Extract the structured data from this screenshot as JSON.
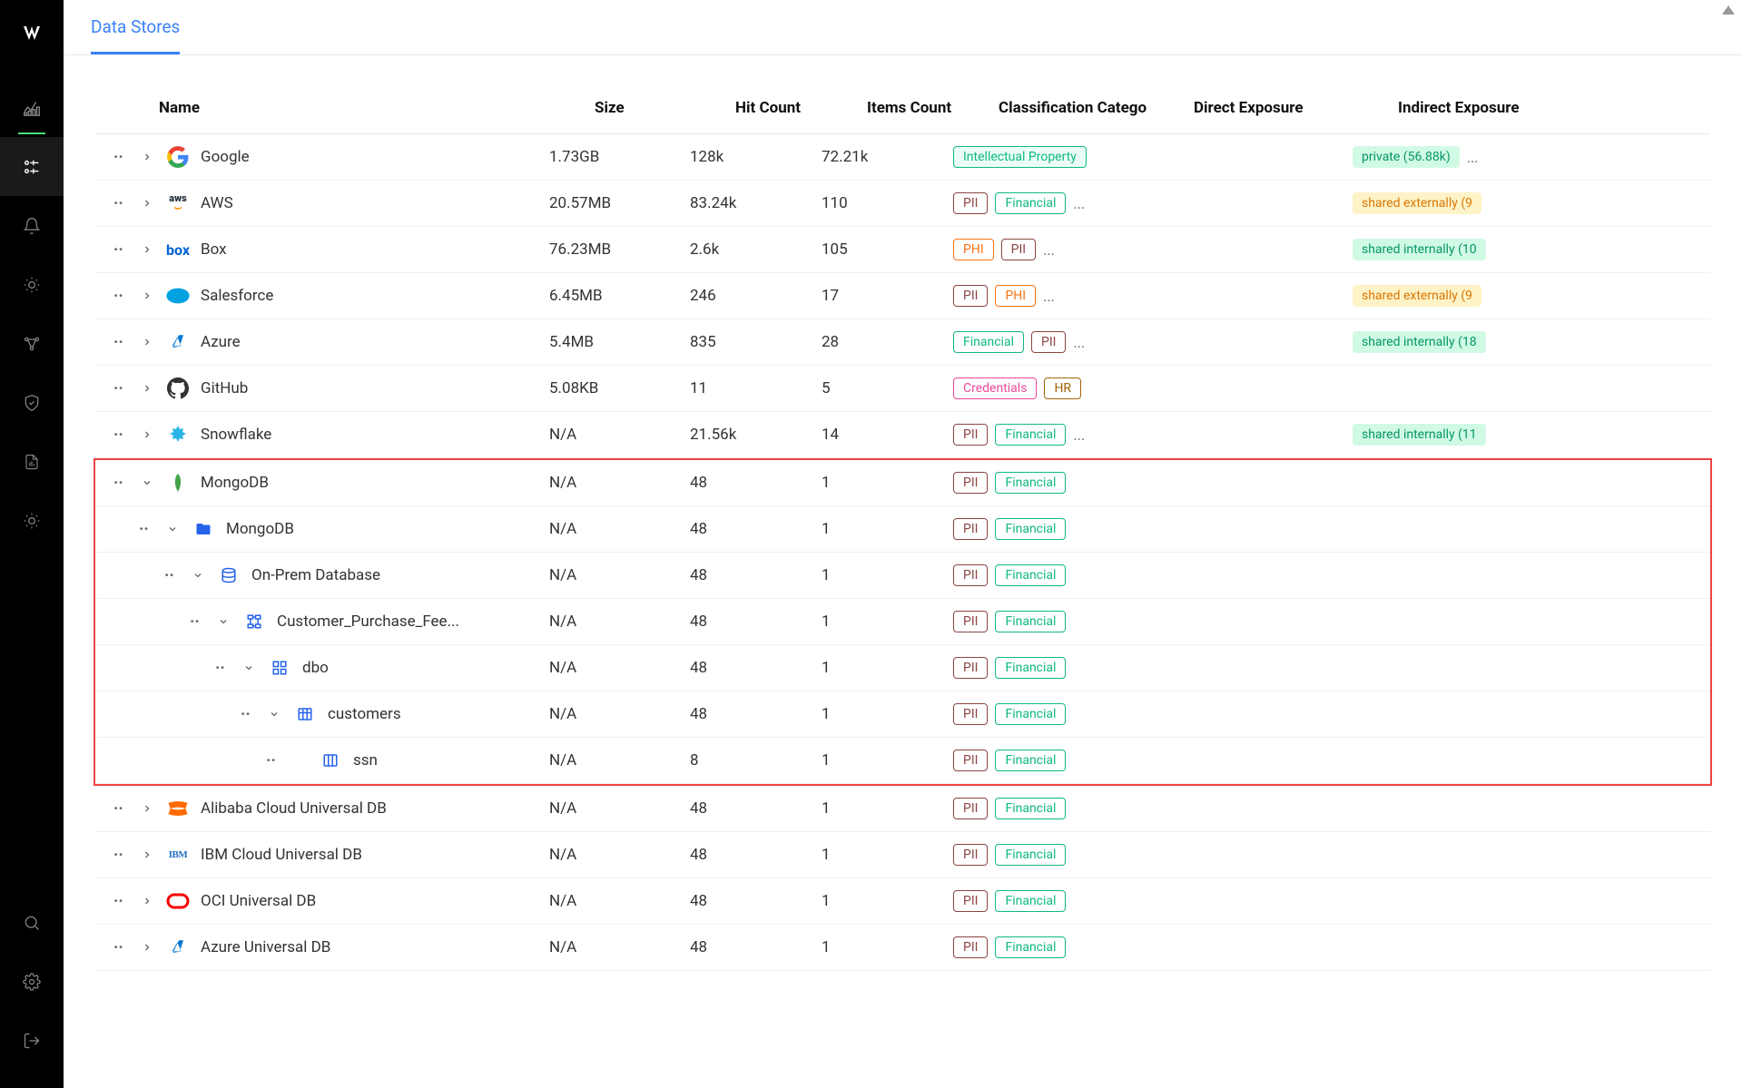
{
  "tabs": {
    "active": "Data Stores"
  },
  "columns": [
    "Name",
    "Size",
    "Hit Count",
    "Items Count",
    "Classification Catego",
    "Direct Exposure",
    "Indirect Exposure"
  ],
  "rows": [
    {
      "name": "Google",
      "icon": "google",
      "size": "1.73GB",
      "hits": "128k",
      "items": "72.21k",
      "tags": [
        {
          "t": "Intellectual Property",
          "c": "ip"
        }
      ],
      "more": false,
      "expo": {
        "t": "private (56.88k)",
        "c": "private"
      },
      "expoMore": true,
      "chev": "right"
    },
    {
      "name": "AWS",
      "icon": "aws",
      "size": "20.57MB",
      "hits": "83.24k",
      "items": "110",
      "tags": [
        {
          "t": "PII",
          "c": "pii"
        },
        {
          "t": "Financial",
          "c": "financial"
        }
      ],
      "more": true,
      "expo": {
        "t": "shared externally (9",
        "c": "ext"
      },
      "chev": "right"
    },
    {
      "name": "Box",
      "icon": "box",
      "size": "76.23MB",
      "hits": "2.6k",
      "items": "105",
      "tags": [
        {
          "t": "PHI",
          "c": "phi"
        },
        {
          "t": "PII",
          "c": "pii"
        }
      ],
      "more": true,
      "expo": {
        "t": "shared internally (10",
        "c": "int"
      },
      "chev": "right"
    },
    {
      "name": "Salesforce",
      "icon": "salesforce",
      "size": "6.45MB",
      "hits": "246",
      "items": "17",
      "tags": [
        {
          "t": "PII",
          "c": "pii"
        },
        {
          "t": "PHI",
          "c": "phi"
        }
      ],
      "more": true,
      "expo": {
        "t": "shared externally (9",
        "c": "ext"
      },
      "chev": "right"
    },
    {
      "name": "Azure",
      "icon": "azure",
      "size": "5.4MB",
      "hits": "835",
      "items": "28",
      "tags": [
        {
          "t": "Financial",
          "c": "financial"
        },
        {
          "t": "PII",
          "c": "pii"
        }
      ],
      "more": true,
      "expo": {
        "t": "shared internally (18",
        "c": "int"
      },
      "chev": "right"
    },
    {
      "name": "GitHub",
      "icon": "github",
      "size": "5.08KB",
      "hits": "11",
      "items": "5",
      "tags": [
        {
          "t": "Credentials",
          "c": "credentials"
        },
        {
          "t": "HR",
          "c": "hr"
        }
      ],
      "more": false,
      "chev": "right"
    },
    {
      "name": "Snowflake",
      "icon": "snowflake",
      "size": "N/A",
      "hits": "21.56k",
      "items": "14",
      "tags": [
        {
          "t": "PII",
          "c": "pii"
        },
        {
          "t": "Financial",
          "c": "financial"
        }
      ],
      "more": true,
      "expo": {
        "t": "shared internally (11",
        "c": "int"
      },
      "chev": "right"
    }
  ],
  "highlighted": [
    {
      "name": "MongoDB",
      "icon": "mongodb",
      "size": "N/A",
      "hits": "48",
      "items": "1",
      "tags": [
        {
          "t": "PII",
          "c": "pii"
        },
        {
          "t": "Financial",
          "c": "financial"
        }
      ],
      "chev": "down",
      "indent": 0
    },
    {
      "name": "MongoDB",
      "icon": "folder",
      "size": "N/A",
      "hits": "48",
      "items": "1",
      "tags": [
        {
          "t": "PII",
          "c": "pii"
        },
        {
          "t": "Financial",
          "c": "financial"
        }
      ],
      "chev": "down",
      "indent": 1
    },
    {
      "name": "On-Prem Database",
      "icon": "db",
      "size": "N/A",
      "hits": "48",
      "items": "1",
      "tags": [
        {
          "t": "PII",
          "c": "pii"
        },
        {
          "t": "Financial",
          "c": "financial"
        }
      ],
      "chev": "down",
      "indent": 2
    },
    {
      "name": "Customer_Purchase_Fee...",
      "icon": "schema",
      "size": "N/A",
      "hits": "48",
      "items": "1",
      "tags": [
        {
          "t": "PII",
          "c": "pii"
        },
        {
          "t": "Financial",
          "c": "financial"
        }
      ],
      "chev": "down",
      "indent": 3
    },
    {
      "name": "dbo",
      "icon": "grid",
      "size": "N/A",
      "hits": "48",
      "items": "1",
      "tags": [
        {
          "t": "PII",
          "c": "pii"
        },
        {
          "t": "Financial",
          "c": "financial"
        }
      ],
      "chev": "down",
      "indent": 4
    },
    {
      "name": "customers",
      "icon": "table",
      "size": "N/A",
      "hits": "48",
      "items": "1",
      "tags": [
        {
          "t": "PII",
          "c": "pii"
        },
        {
          "t": "Financial",
          "c": "financial"
        }
      ],
      "chev": "down",
      "indent": 5
    },
    {
      "name": "ssn",
      "icon": "column",
      "size": "N/A",
      "hits": "8",
      "items": "1",
      "tags": [
        {
          "t": "PII",
          "c": "pii"
        },
        {
          "t": "Financial",
          "c": "financial"
        }
      ],
      "chev": "none",
      "indent": 6
    }
  ],
  "rows2": [
    {
      "name": "Alibaba Cloud Universal DB",
      "icon": "alibaba",
      "size": "N/A",
      "hits": "48",
      "items": "1",
      "tags": [
        {
          "t": "PII",
          "c": "pii"
        },
        {
          "t": "Financial",
          "c": "financial"
        }
      ],
      "chev": "right"
    },
    {
      "name": "IBM Cloud Universal DB",
      "icon": "ibm",
      "size": "N/A",
      "hits": "48",
      "items": "1",
      "tags": [
        {
          "t": "PII",
          "c": "pii"
        },
        {
          "t": "Financial",
          "c": "financial"
        }
      ],
      "chev": "right"
    },
    {
      "name": "OCI Universal DB",
      "icon": "oracle",
      "size": "N/A",
      "hits": "48",
      "items": "1",
      "tags": [
        {
          "t": "PII",
          "c": "pii"
        },
        {
          "t": "Financial",
          "c": "financial"
        }
      ],
      "chev": "right"
    },
    {
      "name": "Azure Universal DB",
      "icon": "azure2",
      "size": "N/A",
      "hits": "48",
      "items": "1",
      "tags": [
        {
          "t": "PII",
          "c": "pii"
        },
        {
          "t": "Financial",
          "c": "financial"
        }
      ],
      "chev": "right"
    }
  ]
}
